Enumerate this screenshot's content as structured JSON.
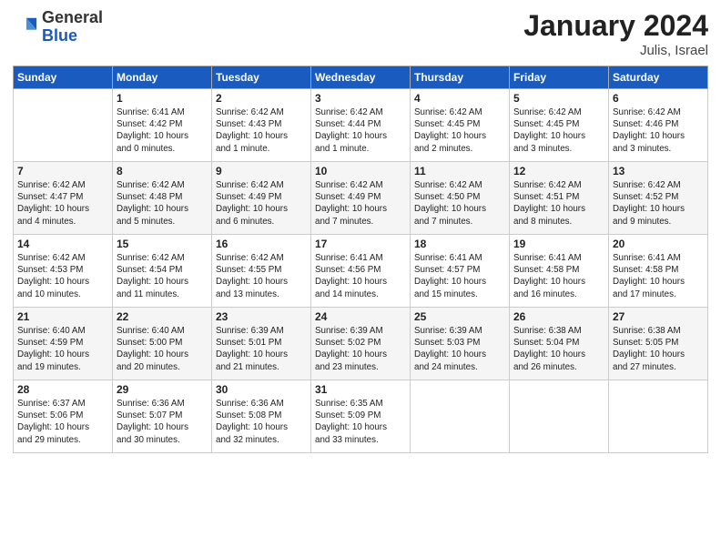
{
  "header": {
    "logo_general": "General",
    "logo_blue": "Blue",
    "month_title": "January 2024",
    "location": "Julis, Israel"
  },
  "days_of_week": [
    "Sunday",
    "Monday",
    "Tuesday",
    "Wednesday",
    "Thursday",
    "Friday",
    "Saturday"
  ],
  "weeks": [
    [
      {
        "day": "",
        "info": ""
      },
      {
        "day": "1",
        "info": "Sunrise: 6:41 AM\nSunset: 4:42 PM\nDaylight: 10 hours\nand 0 minutes."
      },
      {
        "day": "2",
        "info": "Sunrise: 6:42 AM\nSunset: 4:43 PM\nDaylight: 10 hours\nand 1 minute."
      },
      {
        "day": "3",
        "info": "Sunrise: 6:42 AM\nSunset: 4:44 PM\nDaylight: 10 hours\nand 1 minute."
      },
      {
        "day": "4",
        "info": "Sunrise: 6:42 AM\nSunset: 4:45 PM\nDaylight: 10 hours\nand 2 minutes."
      },
      {
        "day": "5",
        "info": "Sunrise: 6:42 AM\nSunset: 4:45 PM\nDaylight: 10 hours\nand 3 minutes."
      },
      {
        "day": "6",
        "info": "Sunrise: 6:42 AM\nSunset: 4:46 PM\nDaylight: 10 hours\nand 3 minutes."
      }
    ],
    [
      {
        "day": "7",
        "info": "Sunrise: 6:42 AM\nSunset: 4:47 PM\nDaylight: 10 hours\nand 4 minutes."
      },
      {
        "day": "8",
        "info": "Sunrise: 6:42 AM\nSunset: 4:48 PM\nDaylight: 10 hours\nand 5 minutes."
      },
      {
        "day": "9",
        "info": "Sunrise: 6:42 AM\nSunset: 4:49 PM\nDaylight: 10 hours\nand 6 minutes."
      },
      {
        "day": "10",
        "info": "Sunrise: 6:42 AM\nSunset: 4:49 PM\nDaylight: 10 hours\nand 7 minutes."
      },
      {
        "day": "11",
        "info": "Sunrise: 6:42 AM\nSunset: 4:50 PM\nDaylight: 10 hours\nand 7 minutes."
      },
      {
        "day": "12",
        "info": "Sunrise: 6:42 AM\nSunset: 4:51 PM\nDaylight: 10 hours\nand 8 minutes."
      },
      {
        "day": "13",
        "info": "Sunrise: 6:42 AM\nSunset: 4:52 PM\nDaylight: 10 hours\nand 9 minutes."
      }
    ],
    [
      {
        "day": "14",
        "info": "Sunrise: 6:42 AM\nSunset: 4:53 PM\nDaylight: 10 hours\nand 10 minutes."
      },
      {
        "day": "15",
        "info": "Sunrise: 6:42 AM\nSunset: 4:54 PM\nDaylight: 10 hours\nand 11 minutes."
      },
      {
        "day": "16",
        "info": "Sunrise: 6:42 AM\nSunset: 4:55 PM\nDaylight: 10 hours\nand 13 minutes."
      },
      {
        "day": "17",
        "info": "Sunrise: 6:41 AM\nSunset: 4:56 PM\nDaylight: 10 hours\nand 14 minutes."
      },
      {
        "day": "18",
        "info": "Sunrise: 6:41 AM\nSunset: 4:57 PM\nDaylight: 10 hours\nand 15 minutes."
      },
      {
        "day": "19",
        "info": "Sunrise: 6:41 AM\nSunset: 4:58 PM\nDaylight: 10 hours\nand 16 minutes."
      },
      {
        "day": "20",
        "info": "Sunrise: 6:41 AM\nSunset: 4:58 PM\nDaylight: 10 hours\nand 17 minutes."
      }
    ],
    [
      {
        "day": "21",
        "info": "Sunrise: 6:40 AM\nSunset: 4:59 PM\nDaylight: 10 hours\nand 19 minutes."
      },
      {
        "day": "22",
        "info": "Sunrise: 6:40 AM\nSunset: 5:00 PM\nDaylight: 10 hours\nand 20 minutes."
      },
      {
        "day": "23",
        "info": "Sunrise: 6:39 AM\nSunset: 5:01 PM\nDaylight: 10 hours\nand 21 minutes."
      },
      {
        "day": "24",
        "info": "Sunrise: 6:39 AM\nSunset: 5:02 PM\nDaylight: 10 hours\nand 23 minutes."
      },
      {
        "day": "25",
        "info": "Sunrise: 6:39 AM\nSunset: 5:03 PM\nDaylight: 10 hours\nand 24 minutes."
      },
      {
        "day": "26",
        "info": "Sunrise: 6:38 AM\nSunset: 5:04 PM\nDaylight: 10 hours\nand 26 minutes."
      },
      {
        "day": "27",
        "info": "Sunrise: 6:38 AM\nSunset: 5:05 PM\nDaylight: 10 hours\nand 27 minutes."
      }
    ],
    [
      {
        "day": "28",
        "info": "Sunrise: 6:37 AM\nSunset: 5:06 PM\nDaylight: 10 hours\nand 29 minutes."
      },
      {
        "day": "29",
        "info": "Sunrise: 6:36 AM\nSunset: 5:07 PM\nDaylight: 10 hours\nand 30 minutes."
      },
      {
        "day": "30",
        "info": "Sunrise: 6:36 AM\nSunset: 5:08 PM\nDaylight: 10 hours\nand 32 minutes."
      },
      {
        "day": "31",
        "info": "Sunrise: 6:35 AM\nSunset: 5:09 PM\nDaylight: 10 hours\nand 33 minutes."
      },
      {
        "day": "",
        "info": ""
      },
      {
        "day": "",
        "info": ""
      },
      {
        "day": "",
        "info": ""
      }
    ]
  ]
}
